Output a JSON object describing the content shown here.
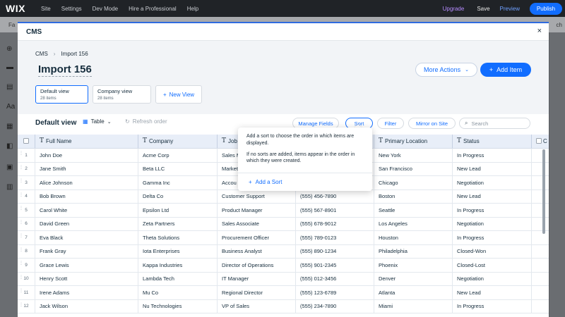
{
  "topbar": {
    "logo": "WIX",
    "nav": [
      "Site",
      "Settings",
      "Dev Mode",
      "Hire a Professional",
      "Help"
    ],
    "upgrade": "Upgrade",
    "save": "Save",
    "preview": "Preview",
    "publish": "Publish"
  },
  "subbar": {
    "left_fragment": "Fa",
    "right_fragment": "ch"
  },
  "modal": {
    "title": "CMS",
    "close_icon": "×"
  },
  "breadcrumb": {
    "root": "CMS",
    "current": "Import 156"
  },
  "page": {
    "title": "Import 156",
    "more_actions": "More Actions",
    "add_item": "Add Item"
  },
  "views": [
    {
      "name": "Default view",
      "count": "28 items"
    },
    {
      "name": "Company view",
      "count": "28 items"
    }
  ],
  "new_view": "New View",
  "toolbar": {
    "view_title": "Default view",
    "layout": "Table",
    "refresh": "Refresh order",
    "manage_fields": "Manage Fields",
    "sort": "Sort",
    "filter": "Filter",
    "mirror": "Mirror on Site",
    "search_placeholder": "Search"
  },
  "table": {
    "columns": [
      "Full Name",
      "Company",
      "Job",
      "",
      "Primary Location",
      "Status",
      "C"
    ],
    "rows": [
      {
        "n": "1",
        "name": "John Doe",
        "company": "Acme Corp",
        "job": "Sales M",
        "phone": "",
        "location": "New York",
        "status": "In Progress"
      },
      {
        "n": "2",
        "name": "Jane Smith",
        "company": "Beta LLC",
        "job": "Market",
        "phone": "",
        "location": "San Francisco",
        "status": "New Lead"
      },
      {
        "n": "3",
        "name": "Alice Johnson",
        "company": "Gamma Inc",
        "job": "Accou",
        "phone": "",
        "location": "Chicago",
        "status": "Negotiation"
      },
      {
        "n": "4",
        "name": "Bob Brown",
        "company": "Delta Co",
        "job": "Customer Support",
        "phone": "(555) 456-7890",
        "location": "Boston",
        "status": "New Lead"
      },
      {
        "n": "5",
        "name": "Carol White",
        "company": "Epsilon Ltd",
        "job": "Product Manager",
        "phone": "(555) 567-8901",
        "location": "Seattle",
        "status": "In Progress"
      },
      {
        "n": "6",
        "name": "David Green",
        "company": "Zeta Partners",
        "job": "Sales Associate",
        "phone": "(555) 678-9012",
        "location": "Los Angeles",
        "status": "Negotiation"
      },
      {
        "n": "7",
        "name": "Eva Black",
        "company": "Theta Solutions",
        "job": "Procurement Officer",
        "phone": "(555) 789-0123",
        "location": "Houston",
        "status": "In Progress"
      },
      {
        "n": "8",
        "name": "Frank Gray",
        "company": "Iota Enterprises",
        "job": "Business Analyst",
        "phone": "(555) 890-1234",
        "location": "Philadelphia",
        "status": "Closed-Won"
      },
      {
        "n": "9",
        "name": "Grace Lewis",
        "company": "Kappa Industries",
        "job": "Director of Operations",
        "phone": "(555) 901-2345",
        "location": "Phoenix",
        "status": "Closed-Lost"
      },
      {
        "n": "10",
        "name": "Henry Scott",
        "company": "Lambda Tech",
        "job": "IT Manager",
        "phone": "(555) 012-3456",
        "location": "Denver",
        "status": "Negotiation"
      },
      {
        "n": "11",
        "name": "Irene Adams",
        "company": "Mu Co",
        "job": "Regional Director",
        "phone": "(555) 123-6789",
        "location": "Atlanta",
        "status": "New Lead"
      },
      {
        "n": "12",
        "name": "Jack Wilson",
        "company": "Nu Technologies",
        "job": "VP of Sales",
        "phone": "(555) 234-7890",
        "location": "Miami",
        "status": "In Progress"
      }
    ]
  },
  "sort_popover": {
    "text1": "Add a sort to choose the order in which items are displayed.",
    "text2": "If no sorts are added, items appear in the order in which they were created.",
    "add_sort": "Add a Sort"
  },
  "colors": {
    "accent": "#116dff",
    "topbar_bg": "#202327",
    "header_bg": "#e8eef8",
    "upgrade": "#b58cff"
  }
}
